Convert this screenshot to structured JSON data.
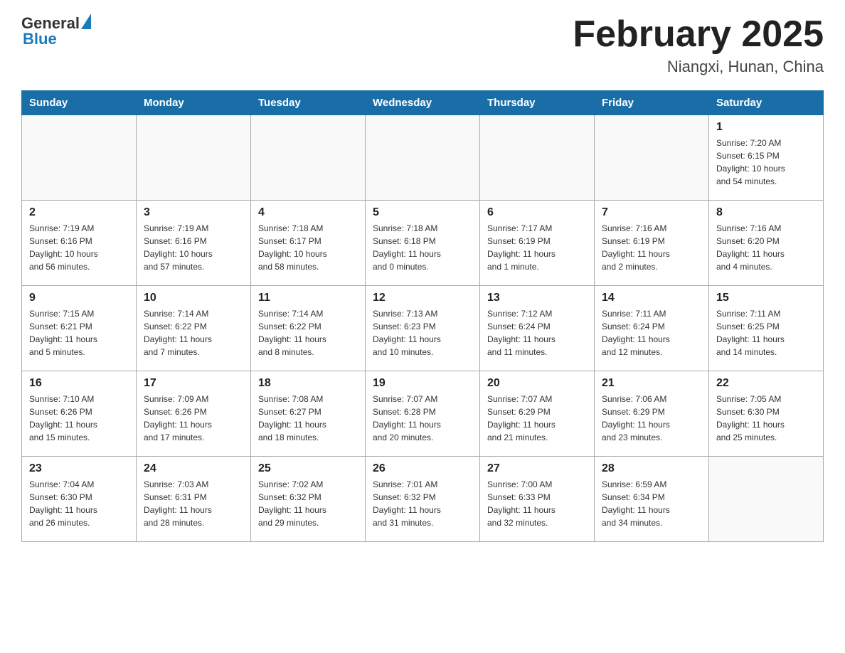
{
  "header": {
    "logo_general": "General",
    "logo_blue": "Blue",
    "month_title": "February 2025",
    "location": "Niangxi, Hunan, China"
  },
  "days_of_week": [
    "Sunday",
    "Monday",
    "Tuesday",
    "Wednesday",
    "Thursday",
    "Friday",
    "Saturday"
  ],
  "weeks": [
    [
      {
        "day": "",
        "info": ""
      },
      {
        "day": "",
        "info": ""
      },
      {
        "day": "",
        "info": ""
      },
      {
        "day": "",
        "info": ""
      },
      {
        "day": "",
        "info": ""
      },
      {
        "day": "",
        "info": ""
      },
      {
        "day": "1",
        "info": "Sunrise: 7:20 AM\nSunset: 6:15 PM\nDaylight: 10 hours\nand 54 minutes."
      }
    ],
    [
      {
        "day": "2",
        "info": "Sunrise: 7:19 AM\nSunset: 6:16 PM\nDaylight: 10 hours\nand 56 minutes."
      },
      {
        "day": "3",
        "info": "Sunrise: 7:19 AM\nSunset: 6:16 PM\nDaylight: 10 hours\nand 57 minutes."
      },
      {
        "day": "4",
        "info": "Sunrise: 7:18 AM\nSunset: 6:17 PM\nDaylight: 10 hours\nand 58 minutes."
      },
      {
        "day": "5",
        "info": "Sunrise: 7:18 AM\nSunset: 6:18 PM\nDaylight: 11 hours\nand 0 minutes."
      },
      {
        "day": "6",
        "info": "Sunrise: 7:17 AM\nSunset: 6:19 PM\nDaylight: 11 hours\nand 1 minute."
      },
      {
        "day": "7",
        "info": "Sunrise: 7:16 AM\nSunset: 6:19 PM\nDaylight: 11 hours\nand 2 minutes."
      },
      {
        "day": "8",
        "info": "Sunrise: 7:16 AM\nSunset: 6:20 PM\nDaylight: 11 hours\nand 4 minutes."
      }
    ],
    [
      {
        "day": "9",
        "info": "Sunrise: 7:15 AM\nSunset: 6:21 PM\nDaylight: 11 hours\nand 5 minutes."
      },
      {
        "day": "10",
        "info": "Sunrise: 7:14 AM\nSunset: 6:22 PM\nDaylight: 11 hours\nand 7 minutes."
      },
      {
        "day": "11",
        "info": "Sunrise: 7:14 AM\nSunset: 6:22 PM\nDaylight: 11 hours\nand 8 minutes."
      },
      {
        "day": "12",
        "info": "Sunrise: 7:13 AM\nSunset: 6:23 PM\nDaylight: 11 hours\nand 10 minutes."
      },
      {
        "day": "13",
        "info": "Sunrise: 7:12 AM\nSunset: 6:24 PM\nDaylight: 11 hours\nand 11 minutes."
      },
      {
        "day": "14",
        "info": "Sunrise: 7:11 AM\nSunset: 6:24 PM\nDaylight: 11 hours\nand 12 minutes."
      },
      {
        "day": "15",
        "info": "Sunrise: 7:11 AM\nSunset: 6:25 PM\nDaylight: 11 hours\nand 14 minutes."
      }
    ],
    [
      {
        "day": "16",
        "info": "Sunrise: 7:10 AM\nSunset: 6:26 PM\nDaylight: 11 hours\nand 15 minutes."
      },
      {
        "day": "17",
        "info": "Sunrise: 7:09 AM\nSunset: 6:26 PM\nDaylight: 11 hours\nand 17 minutes."
      },
      {
        "day": "18",
        "info": "Sunrise: 7:08 AM\nSunset: 6:27 PM\nDaylight: 11 hours\nand 18 minutes."
      },
      {
        "day": "19",
        "info": "Sunrise: 7:07 AM\nSunset: 6:28 PM\nDaylight: 11 hours\nand 20 minutes."
      },
      {
        "day": "20",
        "info": "Sunrise: 7:07 AM\nSunset: 6:29 PM\nDaylight: 11 hours\nand 21 minutes."
      },
      {
        "day": "21",
        "info": "Sunrise: 7:06 AM\nSunset: 6:29 PM\nDaylight: 11 hours\nand 23 minutes."
      },
      {
        "day": "22",
        "info": "Sunrise: 7:05 AM\nSunset: 6:30 PM\nDaylight: 11 hours\nand 25 minutes."
      }
    ],
    [
      {
        "day": "23",
        "info": "Sunrise: 7:04 AM\nSunset: 6:30 PM\nDaylight: 11 hours\nand 26 minutes."
      },
      {
        "day": "24",
        "info": "Sunrise: 7:03 AM\nSunset: 6:31 PM\nDaylight: 11 hours\nand 28 minutes."
      },
      {
        "day": "25",
        "info": "Sunrise: 7:02 AM\nSunset: 6:32 PM\nDaylight: 11 hours\nand 29 minutes."
      },
      {
        "day": "26",
        "info": "Sunrise: 7:01 AM\nSunset: 6:32 PM\nDaylight: 11 hours\nand 31 minutes."
      },
      {
        "day": "27",
        "info": "Sunrise: 7:00 AM\nSunset: 6:33 PM\nDaylight: 11 hours\nand 32 minutes."
      },
      {
        "day": "28",
        "info": "Sunrise: 6:59 AM\nSunset: 6:34 PM\nDaylight: 11 hours\nand 34 minutes."
      },
      {
        "day": "",
        "info": ""
      }
    ]
  ]
}
